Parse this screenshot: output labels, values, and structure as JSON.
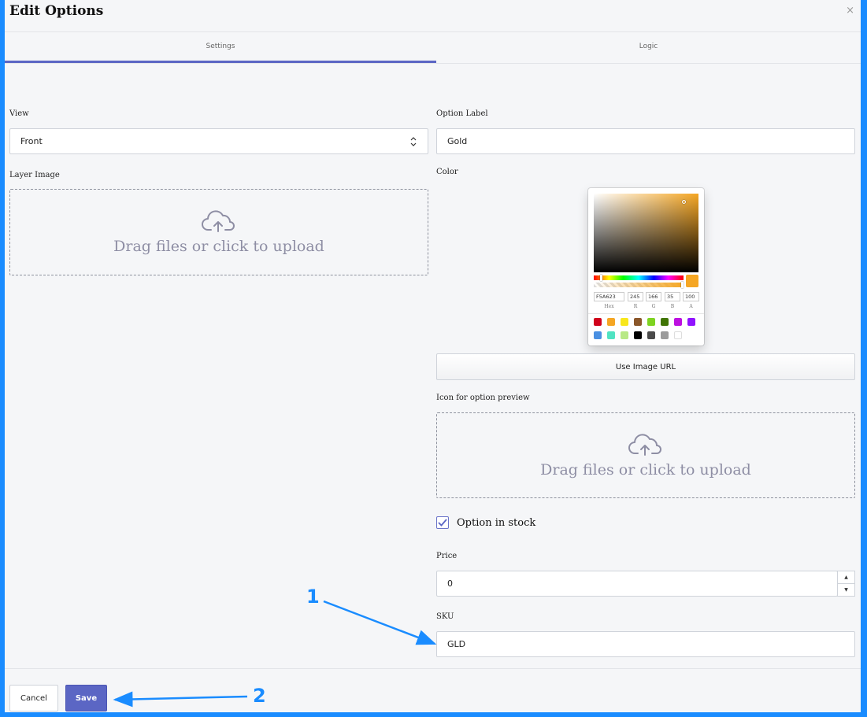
{
  "dialog": {
    "title": "Edit Options",
    "close": "×"
  },
  "tabs": [
    {
      "label": "Settings",
      "active": true
    },
    {
      "label": "Logic",
      "active": false
    }
  ],
  "left": {
    "view_label": "View",
    "view_value": "Front",
    "layer_image_label": "Layer Image",
    "upload_text": "Drag files or click to upload"
  },
  "right": {
    "option_label_label": "Option Label",
    "option_label_value": "Gold",
    "color_label": "Color",
    "picker": {
      "hex": "F5A623",
      "r": "245",
      "g": "166",
      "b": "35",
      "a": "100",
      "hex_label": "Hex",
      "r_label": "R",
      "g_label": "G",
      "b_label": "B",
      "a_label": "A",
      "current_color": "#f5a623",
      "presets": [
        "#d0021b",
        "#f5a623",
        "#f8e71c",
        "#8b572a",
        "#7ed321",
        "#417505",
        "#bd10e0",
        "#9013fe",
        "#4a90e2",
        "#50e3c2",
        "#b8e986",
        "#000000",
        "#4a4a4a",
        "#9b9b9b",
        "#ffffff"
      ]
    },
    "use_image_url": "Use Image URL",
    "icon_preview_label": "Icon for option preview",
    "upload_text": "Drag files or click to upload",
    "in_stock_label": "Option in stock",
    "in_stock_checked": true,
    "price_label": "Price",
    "price_value": "0",
    "sku_label": "SKU",
    "sku_value": "GLD"
  },
  "footer": {
    "cancel": "Cancel",
    "save": "Save"
  },
  "annotations": {
    "one": "1",
    "two": "2",
    "color": "#1a8cff"
  }
}
